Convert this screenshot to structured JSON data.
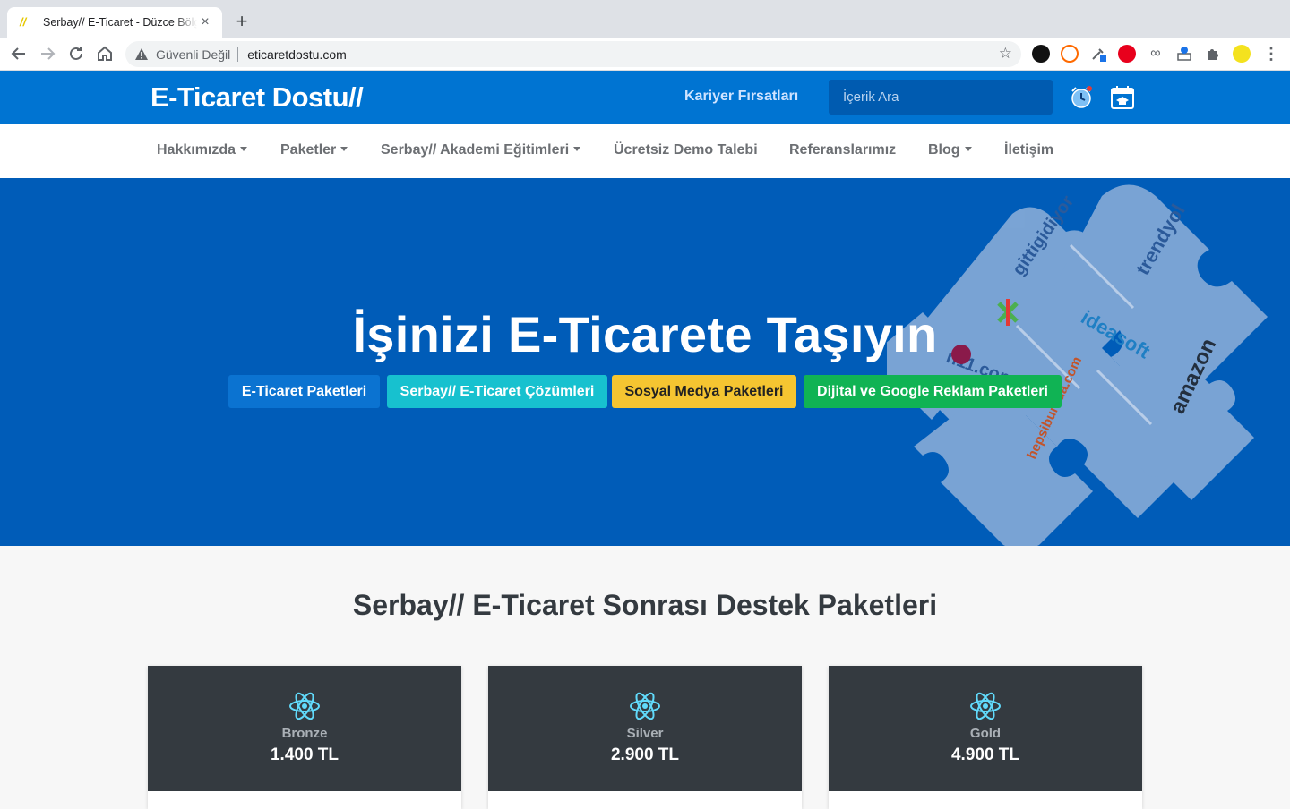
{
  "browser": {
    "tab_title": "Serbay// E-Ticaret - Düzce Bölgesi",
    "tab_favicon": "//",
    "security_label": "Güvenli Değil",
    "url": "eticaretdostu.com"
  },
  "header": {
    "logo": "E-Ticaret Dostu//",
    "career_link": "Kariyer Fırsatları",
    "search_placeholder": "İçerik Ara"
  },
  "nav": {
    "items": [
      {
        "label": "Hakkımızda",
        "dropdown": true
      },
      {
        "label": "Paketler",
        "dropdown": true
      },
      {
        "label": "Serbay// Akademi Eğitimleri",
        "dropdown": true
      },
      {
        "label": "Ücretsiz Demo Talebi",
        "dropdown": false
      },
      {
        "label": "Referanslarımız",
        "dropdown": false
      },
      {
        "label": "Blog",
        "dropdown": true
      },
      {
        "label": "İletişim",
        "dropdown": false
      }
    ]
  },
  "hero": {
    "title": "İşinizi E-Ticarete Taşıyın",
    "buttons": [
      {
        "label": "E-Ticaret Paketleri",
        "color": "#0b73d1",
        "text_color": "#ffffff"
      },
      {
        "label": "Serbay// E-Ticaret Çözümleri",
        "color": "#17c1cf",
        "text_color": "#ffffff"
      },
      {
        "label": "Sosyal Medya Paketleri",
        "color": "#f5c531",
        "text_color": "#222222"
      },
      {
        "label": "Dijital ve Google Reklam Paketleri",
        "color": "#10b354",
        "text_color": "#ffffff"
      }
    ],
    "puzzle_brands": [
      "gittigidiyor",
      "trendyol",
      "ideasoft",
      "n11.com",
      "hepsiburada.com",
      "amazon"
    ]
  },
  "packages": {
    "title": "Serbay// E-Ticaret Sonrası Destek Paketleri",
    "cards": [
      {
        "name": "Bronze",
        "price": "1.400 TL"
      },
      {
        "name": "Silver",
        "price": "2.900 TL"
      },
      {
        "name": "Gold",
        "price": "4.900 TL"
      }
    ]
  },
  "colors": {
    "header_blue": "#0074d2",
    "hero_blue": "#005cb8",
    "card_dark": "#343a40",
    "react_cyan": "#61dafb"
  }
}
